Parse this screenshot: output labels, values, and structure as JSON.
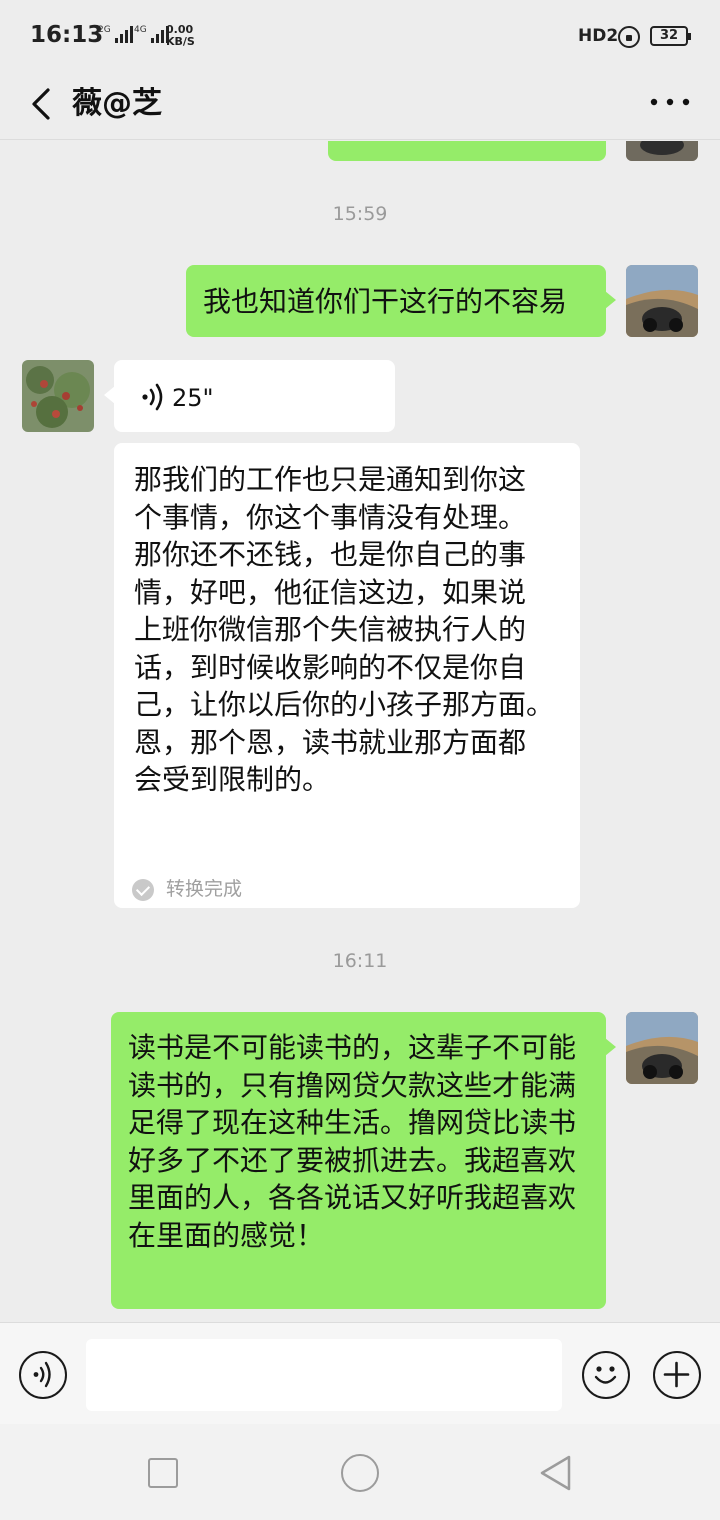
{
  "status_bar": {
    "time": "16:13",
    "signal1": "2G",
    "signal2": "4G",
    "net_speed_value": "0.00",
    "net_speed_unit": "KB/S",
    "hd_label": "HD2",
    "battery": "32"
  },
  "header": {
    "title": "薇@芝",
    "back_icon": "chevron-left-icon",
    "more_icon": "more-horizontal-icon"
  },
  "timestamps": [
    "15:59",
    "16:11"
  ],
  "messages": [
    {
      "side": "right",
      "type": "text",
      "text": "我也知道你们干这行的不容易"
    },
    {
      "side": "left",
      "type": "voice",
      "duration": "25\""
    },
    {
      "side": "left",
      "type": "transcript",
      "lines": [
        "那我们的工作也只是通知到你这",
        "个事情，你这个事情没有处理。",
        "那你还不还钱，也是你自己的事",
        "情，好吧，他征信这边，如果说",
        "上班你微信那个失信被执行人的",
        "话，到时候收影响的不仅是你自",
        "己，让你以后你的小孩子那方面。",
        "恩，那个恩，读书就业那方面都",
        "会受到限制的。"
      ],
      "status": "转换完成"
    },
    {
      "side": "right",
      "type": "text",
      "lines": [
        "读书是不可能读书的，这辈子不可能",
        "读书的，只有撸网贷欠款这些才能满",
        "足得了现在这种生活。撸网贷比读书",
        "好多了不还了要被抓进去。我超喜欢",
        "里面的人，各各说话又好听我超喜欢",
        "在里面的感觉！"
      ]
    }
  ],
  "input_bar": {
    "voice_icon": "voice-input-icon",
    "input_value": "",
    "emoji_icon": "emoji-icon",
    "plus_icon": "plus-icon"
  },
  "nav_bar": {
    "recent_icon": "recent-apps-icon",
    "home_icon": "home-icon",
    "back_icon": "back-triangle-icon"
  },
  "colors": {
    "background": "#ededed",
    "sent_bubble": "#95ec69",
    "received_bubble": "#ffffff",
    "timestamp": "#9a9a9a"
  }
}
